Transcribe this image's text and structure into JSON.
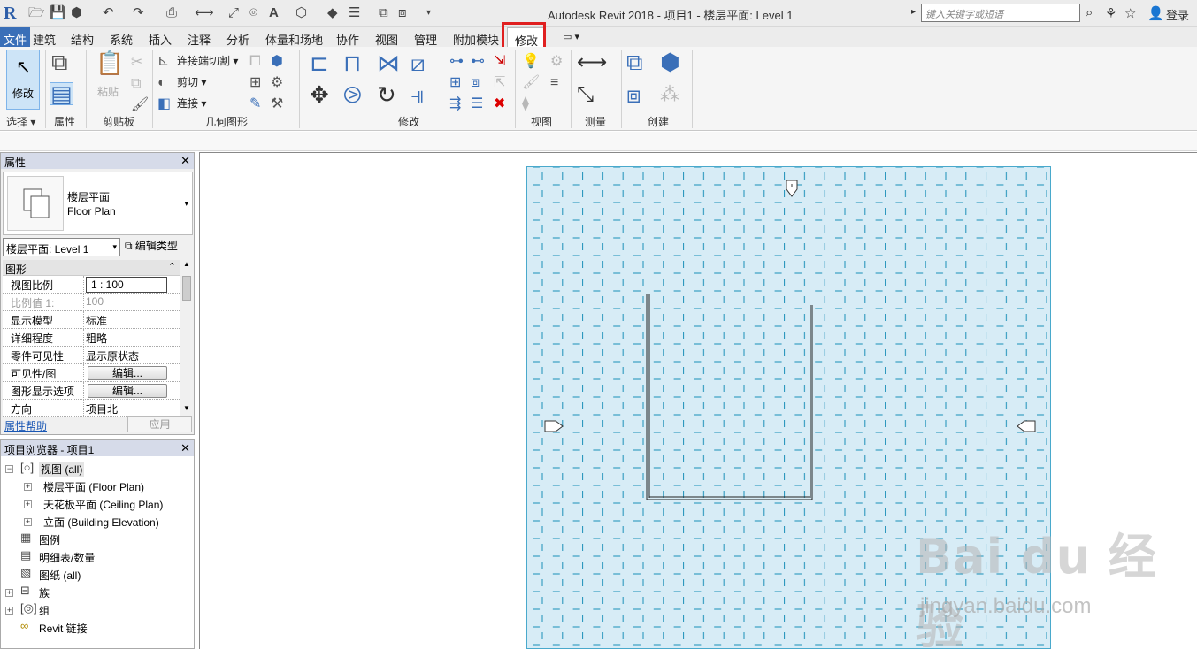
{
  "app": {
    "logo": "R",
    "title": "Autodesk Revit 2018 -     项目1 - 楼层平面: Level 1",
    "search_placeholder": "键入关键字或短语",
    "login": "登录"
  },
  "tabs": [
    "文件",
    "建筑",
    "结构",
    "系统",
    "插入",
    "注释",
    "分析",
    "体量和场地",
    "协作",
    "视图",
    "管理",
    "附加模块",
    "修改"
  ],
  "active_tab": "修改",
  "ribbon": {
    "modify": "修改",
    "paste": "粘贴",
    "cut_geometry": "连接端切割",
    "cut": "剪切",
    "join": "连接",
    "panels": [
      "选择",
      "属性",
      "剪贴板",
      "几何图形",
      "修改",
      "视图",
      "测量",
      "创建"
    ]
  },
  "properties": {
    "title": "属性",
    "type_name_cn": "楼层平面",
    "type_name_en": "Floor Plan",
    "selector": "楼层平面: Level 1",
    "edit_type": "编辑类型",
    "group": "图形",
    "rows": [
      {
        "k": "视图比例",
        "v": "1 : 100"
      },
      {
        "k": "比例值 1:",
        "v": "100"
      },
      {
        "k": "显示模型",
        "v": "标准"
      },
      {
        "k": "详细程度",
        "v": "粗略"
      },
      {
        "k": "零件可见性",
        "v": "显示原状态"
      },
      {
        "k": "可见性/图形...",
        "v": "编辑..."
      },
      {
        "k": "图形显示选项",
        "v": "编辑..."
      },
      {
        "k": "方向",
        "v": "项目北"
      }
    ],
    "help": "属性帮助",
    "apply": "应用"
  },
  "browser": {
    "title": "项目浏览器 - 项目1",
    "nodes": [
      {
        "label": "视图 (all)"
      },
      {
        "label": "楼层平面 (Floor Plan)"
      },
      {
        "label": "天花板平面 (Ceiling Plan)"
      },
      {
        "label": "立面 (Building Elevation)"
      },
      {
        "label": "图例"
      },
      {
        "label": "明细表/数量"
      },
      {
        "label": "图纸 (all)"
      },
      {
        "label": "族"
      },
      {
        "label": "组"
      },
      {
        "label": "Revit 链接"
      }
    ]
  },
  "watermark": {
    "main": "Bai du 经验",
    "sub": "jingyan.baidu.com"
  },
  "colors": {
    "accent": "#3a6fb8",
    "highlight": "#e02020",
    "sheet": "#d7ecf6",
    "grid": "#1a8fb8"
  }
}
